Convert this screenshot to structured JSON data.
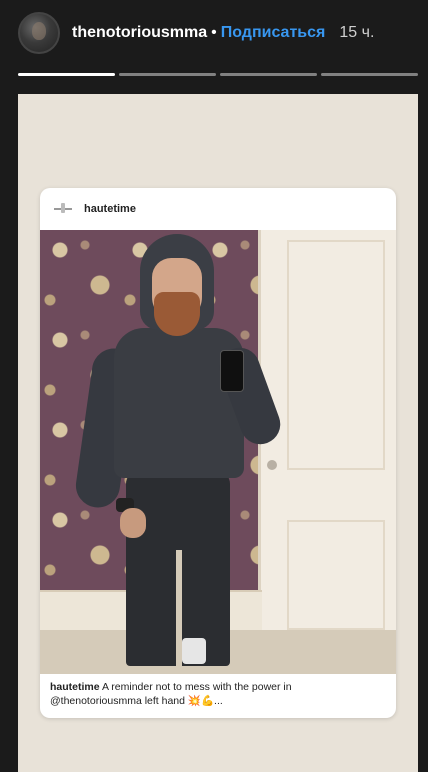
{
  "story": {
    "username": "thenotoriousmma",
    "separator": "•",
    "subscribe_label": "Подписаться",
    "time_ago": "15 ч.",
    "progress": {
      "segments": 4,
      "current": 1,
      "current_fill": 1.0
    }
  },
  "post": {
    "username": "hautetime",
    "caption_user": "hautetime",
    "caption_line1": "A reminder not to mess with the power in",
    "caption_line2": "@thenotoriousmma left hand 💥💪..."
  },
  "colors": {
    "background": "#1b1b1b",
    "accent": "#3897f0",
    "story_bg": "#e8e2d8"
  },
  "icons": {
    "avatar": "profile-avatar",
    "post_avatar": "brand-logo-icon"
  }
}
